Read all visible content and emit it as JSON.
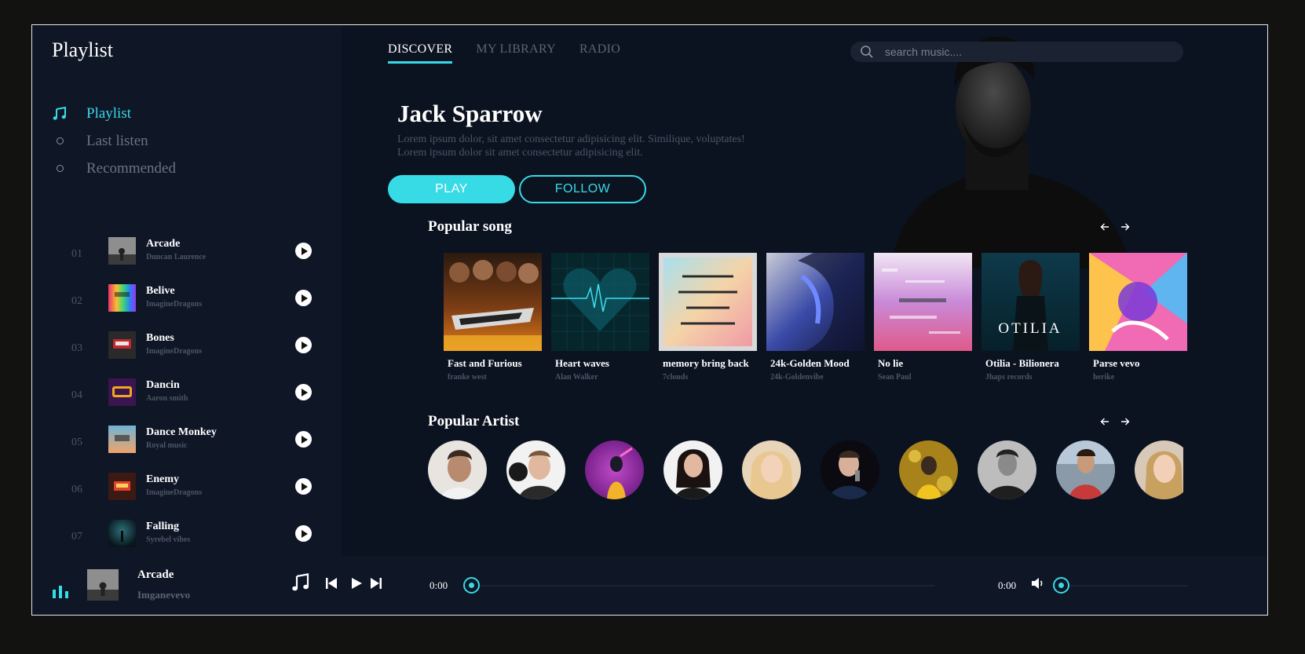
{
  "sidebar": {
    "title": "Playlist",
    "nav": [
      {
        "label": "Playlist",
        "icon": "music-note-icon",
        "active": true
      },
      {
        "label": "Last listen",
        "icon": "circle-bullet-icon",
        "active": false
      },
      {
        "label": "Recommended",
        "icon": "circle-bullet-icon",
        "active": false
      }
    ],
    "tracks": [
      {
        "num": "01",
        "title": "Arcade",
        "artist": "Duncan Laurence"
      },
      {
        "num": "02",
        "title": "Belive",
        "artist": "ImagineDragons"
      },
      {
        "num": "03",
        "title": "Bones",
        "artist": "ImagineDragons"
      },
      {
        "num": "04",
        "title": "Dancin",
        "artist": "Aaron smith"
      },
      {
        "num": "05",
        "title": "Dance Monkey",
        "artist": "Royal music"
      },
      {
        "num": "06",
        "title": "Enemy",
        "artist": "ImagineDragons"
      },
      {
        "num": "07",
        "title": "Falling",
        "artist": "Syrebel vibes"
      }
    ]
  },
  "header": {
    "tabs": [
      {
        "label": "DISCOVER",
        "active": true
      },
      {
        "label": "MY LIBRARY",
        "active": false
      },
      {
        "label": "RADIO",
        "active": false
      }
    ],
    "search_placeholder": "search music...."
  },
  "hero": {
    "artist_name": "Jack Sparrow",
    "description_line1": "Lorem ipsum dolor, sit amet consectetur adipisicing elit. Similique, voluptates!",
    "description_line2": "Lorem ipsum dolor sit amet consectetur adipisicing elit.",
    "play_label": "PLAY",
    "follow_label": "FOLLOW"
  },
  "popular_songs": {
    "title": "Popular song",
    "items": [
      {
        "title": "Fast and Furious",
        "artist": "franke west"
      },
      {
        "title": "Heart waves",
        "artist": "Alan Walker"
      },
      {
        "title": "memory bring back",
        "artist": "7clouds"
      },
      {
        "title": "24k-Golden Mood",
        "artist": "24k-Goldenvibe"
      },
      {
        "title": "No lie",
        "artist": "Sean Paul"
      },
      {
        "title": "Otilia - Bilionera",
        "artist": "Jhaps records"
      },
      {
        "title": "Parse vevo",
        "artist": "herike"
      }
    ],
    "cover_texts": {
      "otilia": "OTILIA"
    }
  },
  "popular_artists": {
    "title": "Popular Artist",
    "count": 10
  },
  "player": {
    "title": "Arcade",
    "artist": "Imganevevo",
    "current_time": "0:00",
    "duration": "0:00",
    "progress": 0,
    "volume": 0
  },
  "colors": {
    "accent": "#37dbe6",
    "background": "#0b1220",
    "sidebar": "#0f1626",
    "muted_text": "#4d5566"
  }
}
